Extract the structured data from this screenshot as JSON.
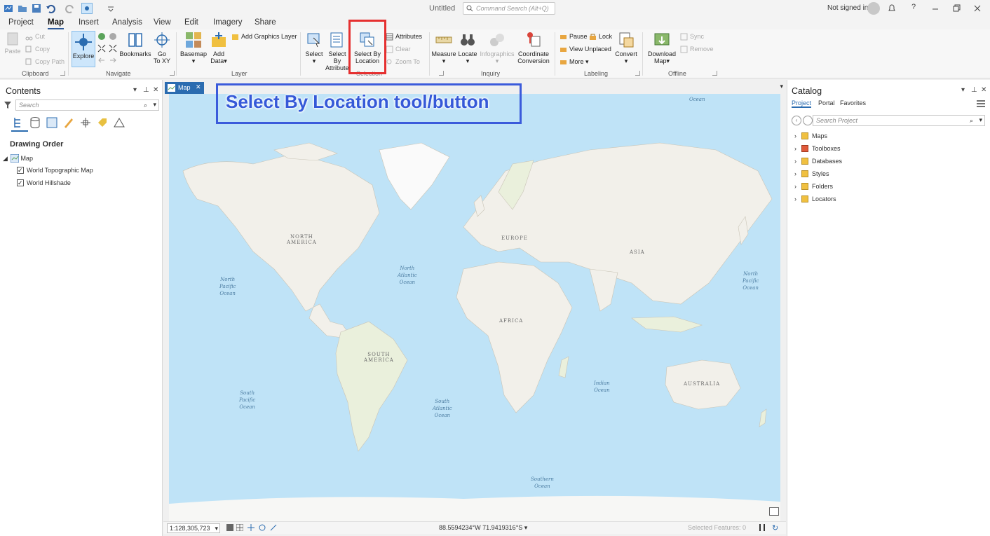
{
  "window": {
    "title": "Untitled",
    "command_search_placeholder": "Command Search (Alt+Q)",
    "signin": "Not signed in"
  },
  "tabs": [
    "Project",
    "Map",
    "Insert",
    "Analysis",
    "View",
    "Edit",
    "Imagery",
    "Share"
  ],
  "active_tab": "Map",
  "ribbon": {
    "clipboard": {
      "label": "Clipboard",
      "paste": "Paste",
      "cut": "Cut",
      "copy": "Copy",
      "copy_path": "Copy Path"
    },
    "navigate": {
      "label": "Navigate",
      "explore": "Explore",
      "bookmarks": "Bookmarks",
      "go_to_xy_1": "Go",
      "go_to_xy_2": "To XY"
    },
    "layer": {
      "label": "Layer",
      "basemap": "Basemap",
      "add_data_1": "Add",
      "add_data_2": "Data",
      "add_graphics_layer": "Add Graphics Layer"
    },
    "selection": {
      "label": "Selection",
      "select": "Select",
      "select_by_attr_1": "Select By",
      "select_by_attr_2": "Attributes",
      "select_by_loc_1": "Select By",
      "select_by_loc_2": "Location",
      "attributes": "Attributes",
      "clear": "Clear",
      "zoom_to": "Zoom To"
    },
    "inquiry": {
      "label": "Inquiry",
      "measure": "Measure",
      "locate": "Locate",
      "infographics": "Infographics",
      "coord_conv_1": "Coordinate",
      "coord_conv_2": "Conversion"
    },
    "labeling": {
      "label": "Labeling",
      "pause": "Pause",
      "lock": "Lock",
      "view_unplaced": "View Unplaced",
      "more": "More",
      "convert": "Convert"
    },
    "offline": {
      "label": "Offline",
      "download_map_1": "Download",
      "download_map_2": "Map",
      "sync": "Sync",
      "remove": "Remove"
    }
  },
  "contents": {
    "title": "Contents",
    "search_placeholder": "Search",
    "drawing_order": "Drawing Order",
    "map_node": "Map",
    "layers": [
      "World Topographic Map",
      "World Hillshade"
    ]
  },
  "catalog": {
    "title": "Catalog",
    "tabs": [
      "Project",
      "Portal",
      "Favorites"
    ],
    "search_placeholder": "Search Project",
    "items": [
      "Maps",
      "Toolboxes",
      "Databases",
      "Styles",
      "Folders",
      "Locators"
    ]
  },
  "map": {
    "tab_label": "Map",
    "scale": "1:128,305,723",
    "coordinates": "88.5594234°W 71.9419316°S",
    "selected_features": "Selected Features: 0",
    "labels": {
      "north_america": "NORTH\nAMERICA",
      "south_america": "SOUTH\nAMERICA",
      "europe": "EUROPE",
      "asia": "ASIA",
      "africa": "AFRICA",
      "australia": "AUSTRALIA",
      "north_pacific_w": "North\nPacific\nOcean",
      "north_pacific_e": "North\nPacific\nOcean",
      "north_atlantic": "North\nAtlantic\nOcean",
      "south_pacific": "South\nPacific\nOcean",
      "south_atlantic": "South\nAtlantic\nOcean",
      "indian": "Indian\nOcean",
      "southern": "Southern\nOcean",
      "arctic": "Ocean"
    }
  },
  "annotation": {
    "text": "Select By Location tool/button"
  },
  "colors": {
    "accent": "#2b6cb0",
    "annotation_blue": "#3559d8",
    "highlight_red": "#e53030",
    "ocean": "#bfe3f7",
    "land": "#f2f0ea"
  }
}
